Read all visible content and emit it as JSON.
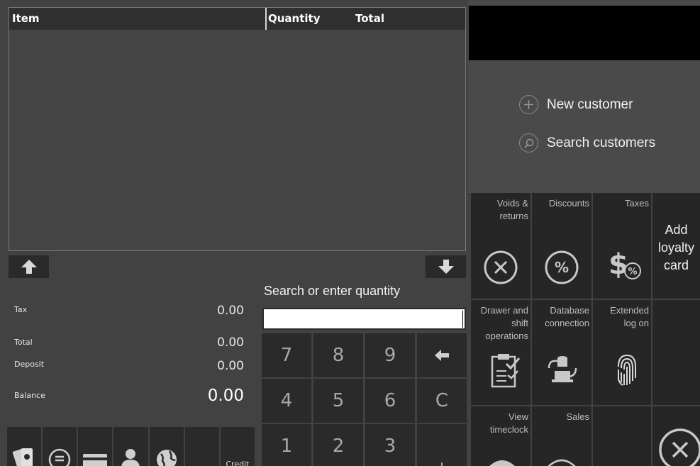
{
  "grid": {
    "columns": [
      "Item",
      "Quantity",
      "Total"
    ],
    "rows": []
  },
  "scroll": {
    "up_icon": "arrow-up-icon",
    "down_icon": "arrow-down-icon"
  },
  "totals": {
    "tax_label": "Tax",
    "tax_value": "0.00",
    "total_label": "Total",
    "total_value": "0.00",
    "deposit_label": "Deposit",
    "deposit_value": "0.00",
    "balance_label": "Balance",
    "balance_value": "0.00"
  },
  "payments": [
    {
      "icon": "cash-icon",
      "label": ""
    },
    {
      "icon": "check-icon",
      "label": ""
    },
    {
      "icon": "card-icon",
      "label": ""
    },
    {
      "icon": "account-icon",
      "label": ""
    },
    {
      "icon": "globe-icon",
      "label": ""
    },
    {
      "icon": "",
      "label": ""
    },
    {
      "icon": "",
      "label": "Credit"
    }
  ],
  "search": {
    "label": "Search or enter quantity",
    "value": ""
  },
  "keypad": [
    "7",
    "8",
    "9",
    "←",
    "4",
    "5",
    "6",
    "C",
    "1",
    "2",
    "3",
    "+"
  ],
  "customer": {
    "new_label": "New customer",
    "search_label": "Search customers"
  },
  "tiles": {
    "voids": "Voids & returns",
    "discounts": "Discounts",
    "taxes": "Taxes",
    "loyalty": "Add loyalty card",
    "drawer": "Drawer and shift operations",
    "database": "Database connection",
    "extended": "Extended log on",
    "timeclock": "View timeclock",
    "sales": "Sales"
  },
  "colors": {
    "background": "#424242",
    "tile": "#262626",
    "key": "#2a2a2a",
    "display": "#000000"
  }
}
